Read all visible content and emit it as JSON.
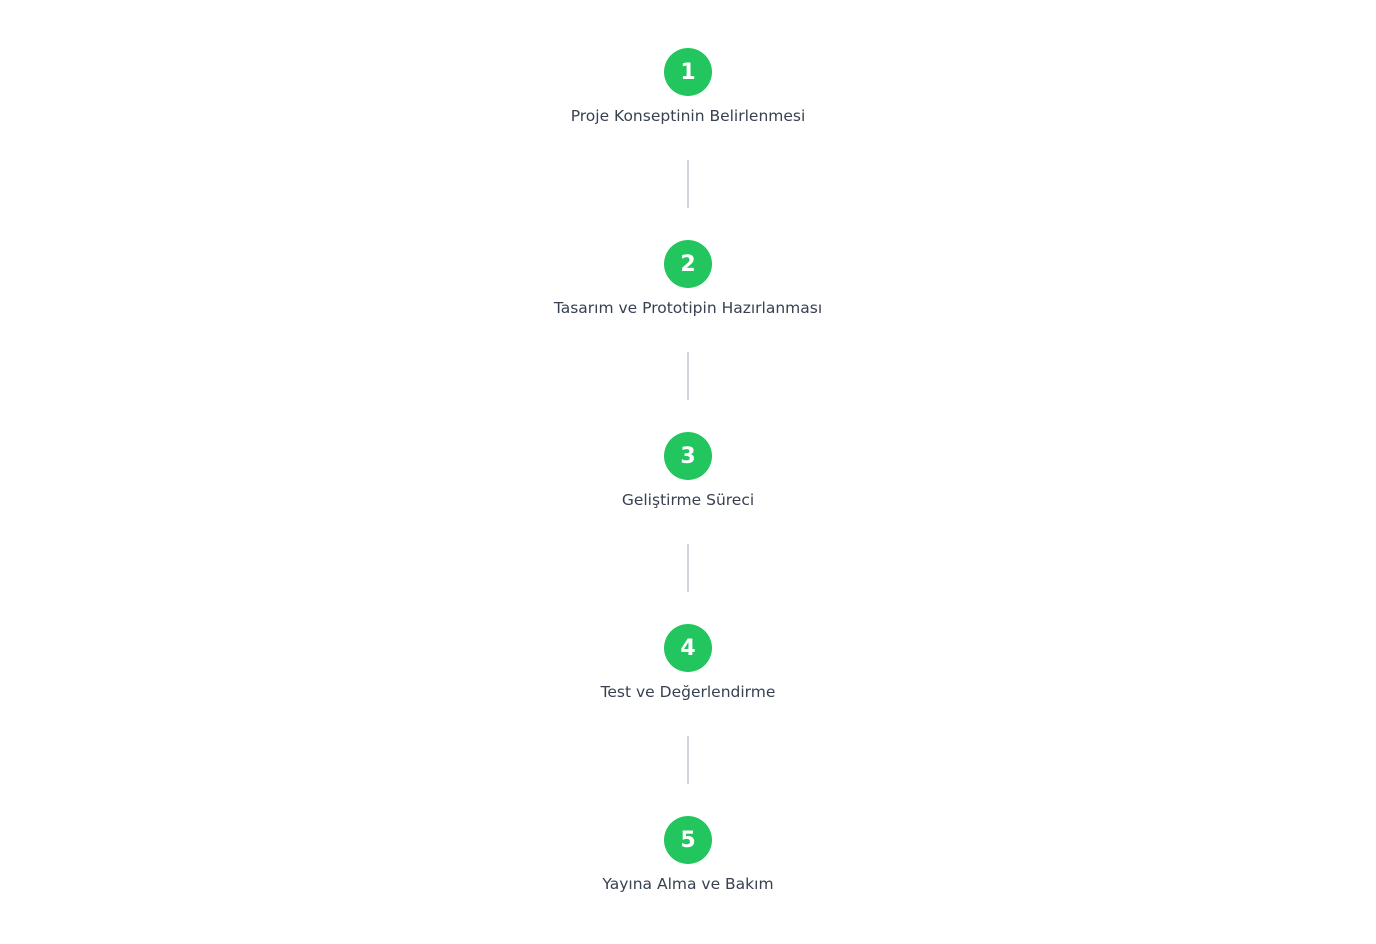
{
  "accent_color": "#22c55e",
  "connector_color": "#d1d5db",
  "steps": [
    {
      "number": "1",
      "label": "Proje Konseptinin Belirlenmesi"
    },
    {
      "number": "2",
      "label": "Tasarım ve Prototipin Hazırlanması"
    },
    {
      "number": "3",
      "label": "Geliştirme Süreci"
    },
    {
      "number": "4",
      "label": "Test ve Değerlendirme"
    },
    {
      "number": "5",
      "label": "Yayına Alma ve Bakım"
    }
  ]
}
